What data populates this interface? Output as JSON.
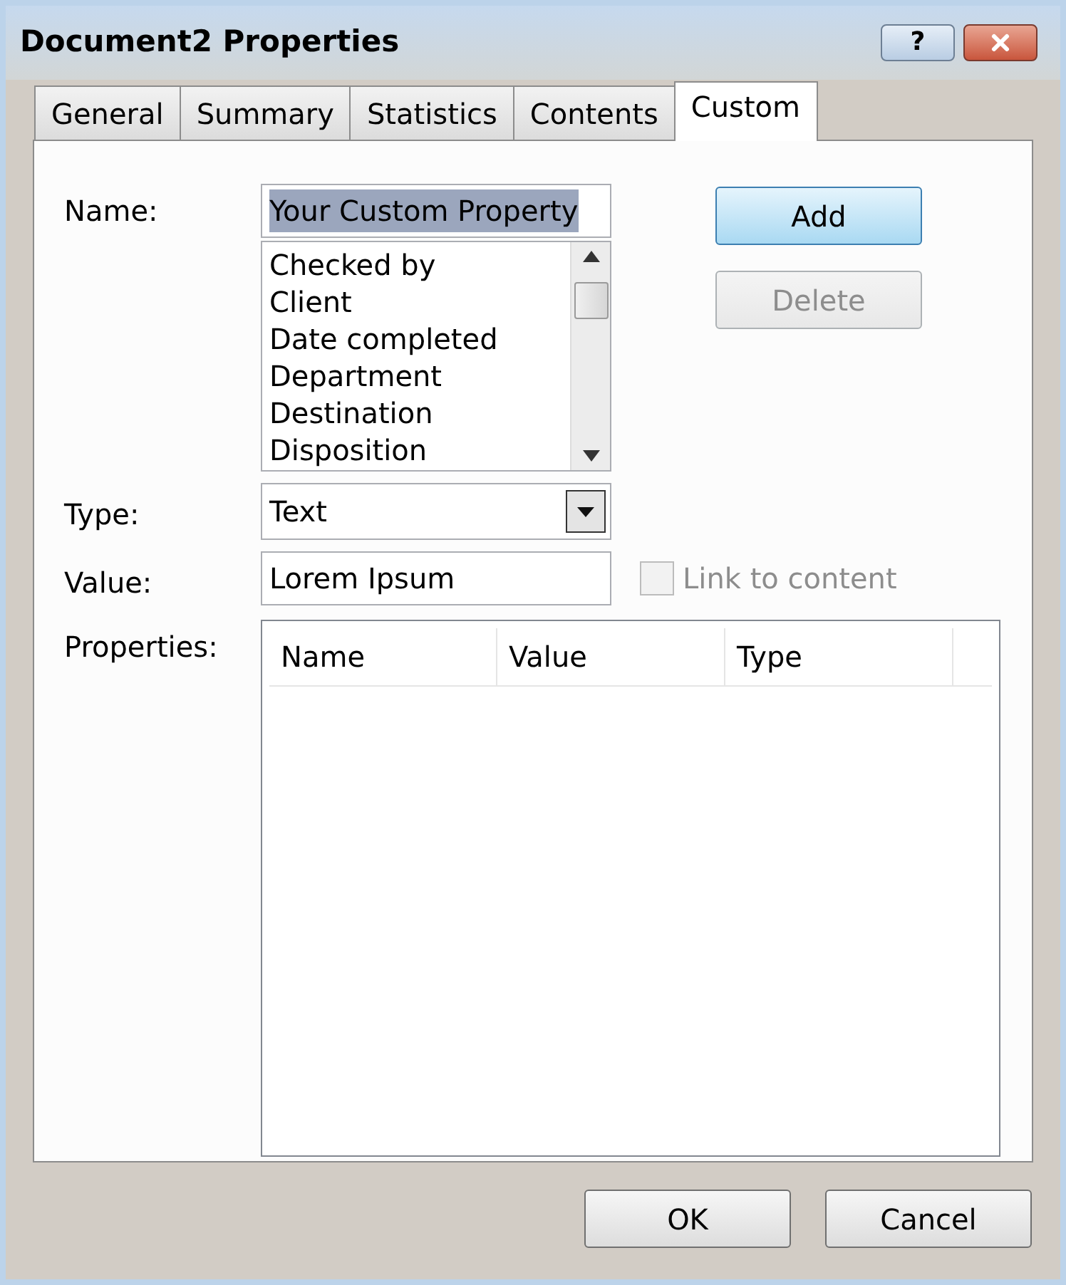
{
  "window": {
    "title": "Document2 Properties",
    "help": "?"
  },
  "tabs": [
    {
      "label": "General",
      "selected": false
    },
    {
      "label": "Summary",
      "selected": false
    },
    {
      "label": "Statistics",
      "selected": false
    },
    {
      "label": "Contents",
      "selected": false
    },
    {
      "label": "Custom",
      "selected": true
    }
  ],
  "name": {
    "label": "Name:",
    "value": "Your Custom Property",
    "value_selected": true
  },
  "name_list": [
    "Checked by",
    "Client",
    "Date completed",
    "Department",
    "Destination",
    "Disposition"
  ],
  "type": {
    "label": "Type:",
    "value": "Text"
  },
  "value": {
    "label": "Value:",
    "value": "Lorem Ipsum"
  },
  "link_to_content": {
    "label": "Link to content",
    "checked": false,
    "disabled": true
  },
  "side_buttons": [
    {
      "label": "Add",
      "default": true,
      "disabled": false
    },
    {
      "label": "Delete",
      "default": false,
      "disabled": true
    }
  ],
  "properties": {
    "label": "Properties:",
    "columns": [
      "Name",
      "Value",
      "Type"
    ]
  },
  "buttons": [
    "OK",
    "Cancel"
  ]
}
